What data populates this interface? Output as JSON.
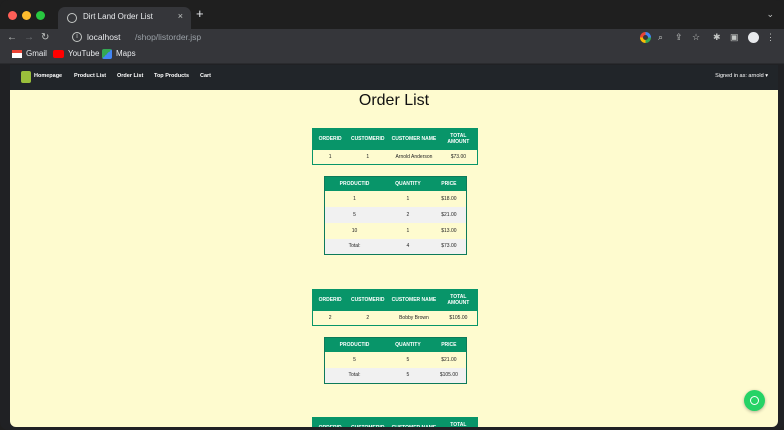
{
  "browser": {
    "tab_title": "Dirt Land Order List",
    "tab_close": "×",
    "new_tab": "+",
    "url_host": "localhost",
    "url_path": "/shop/listorder.jsp",
    "bookmarks": [
      {
        "label": "Gmail",
        "icon": "gmail-icon"
      },
      {
        "label": "YouTube",
        "icon": "youtube-icon"
      },
      {
        "label": "Maps",
        "icon": "maps-icon"
      }
    ]
  },
  "site_nav": {
    "links": [
      "Homepage",
      "Product List",
      "Order List",
      "Top Products",
      "Cart"
    ],
    "signed_in": "Signed in as: arnold ▾"
  },
  "page": {
    "title": "Order List"
  },
  "order_headers": [
    "OrderId",
    "CustomerId",
    "Customer Name",
    "Total Amount"
  ],
  "product_headers": [
    "ProductId",
    "Quantity",
    "Price"
  ],
  "orders": [
    {
      "order_id": "1",
      "customer_id": "1",
      "customer_name": "Arnold Anderson",
      "total": "$73.00",
      "items": [
        {
          "product_id": "1",
          "quantity": "1",
          "price": "$18.00"
        },
        {
          "product_id": "5",
          "quantity": "2",
          "price": "$21.00"
        },
        {
          "product_id": "10",
          "quantity": "1",
          "price": "$13.00"
        }
      ],
      "total_label": "Total:",
      "total_qty": "4",
      "total_price": "$73.00"
    },
    {
      "order_id": "2",
      "customer_id": "2",
      "customer_name": "Bobby Brown",
      "total": "$105.00",
      "items": [
        {
          "product_id": "5",
          "quantity": "5",
          "price": "$21.00"
        }
      ],
      "total_label": "Total:",
      "total_qty": "5",
      "total_price": "$105.00"
    }
  ],
  "colors": {
    "table_header": "#089569",
    "page_background": "#fefbcf",
    "navbar": "#212529"
  }
}
